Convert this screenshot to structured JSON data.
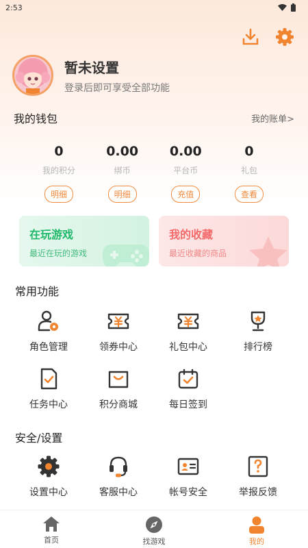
{
  "status": {
    "time": "2:53"
  },
  "header": {
    "download_icon": "download-icon",
    "settings_icon": "gear-icon"
  },
  "profile": {
    "name": "暂未设置",
    "subtitle": "登录后即可享受全部功能"
  },
  "wallet": {
    "title": "我的钱包",
    "bill_link": "我的账单>",
    "items": [
      {
        "value": "0",
        "label": "我的积分",
        "button": "明细"
      },
      {
        "value": "0.00",
        "label": "绑币",
        "button": "明细"
      },
      {
        "value": "0.00",
        "label": "平台币",
        "button": "充值"
      },
      {
        "value": "0",
        "label": "礼包",
        "button": "查看"
      }
    ]
  },
  "cards": [
    {
      "title": "在玩游戏",
      "subtitle": "最近在玩的游戏"
    },
    {
      "title": "我的收藏",
      "subtitle": "最近收藏的商品"
    }
  ],
  "common": {
    "title": "常用功能",
    "items": [
      {
        "label": "角色管理",
        "icon": "role-icon"
      },
      {
        "label": "领券中心",
        "icon": "coupon-icon"
      },
      {
        "label": "礼包中心",
        "icon": "gift-coupon-icon"
      },
      {
        "label": "排行榜",
        "icon": "trophy-icon"
      },
      {
        "label": "任务中心",
        "icon": "task-icon"
      },
      {
        "label": "积分商城",
        "icon": "shop-bag-icon"
      },
      {
        "label": "每日签到",
        "icon": "checkin-icon"
      }
    ]
  },
  "security": {
    "title": "安全/设置",
    "items": [
      {
        "label": "设置中心",
        "icon": "gear-icon"
      },
      {
        "label": "客服中心",
        "icon": "headset-icon"
      },
      {
        "label": "帐号安全",
        "icon": "id-card-icon"
      },
      {
        "label": "举报反馈",
        "icon": "question-icon"
      }
    ]
  },
  "tabbar": {
    "tabs": [
      {
        "label": "首页",
        "icon": "home-icon"
      },
      {
        "label": "找游戏",
        "icon": "compass-icon"
      },
      {
        "label": "我的",
        "icon": "user-icon",
        "active": true
      }
    ]
  },
  "colors": {
    "accent": "#f0842f",
    "green": "#20b86a",
    "pink": "#f36b6b"
  }
}
